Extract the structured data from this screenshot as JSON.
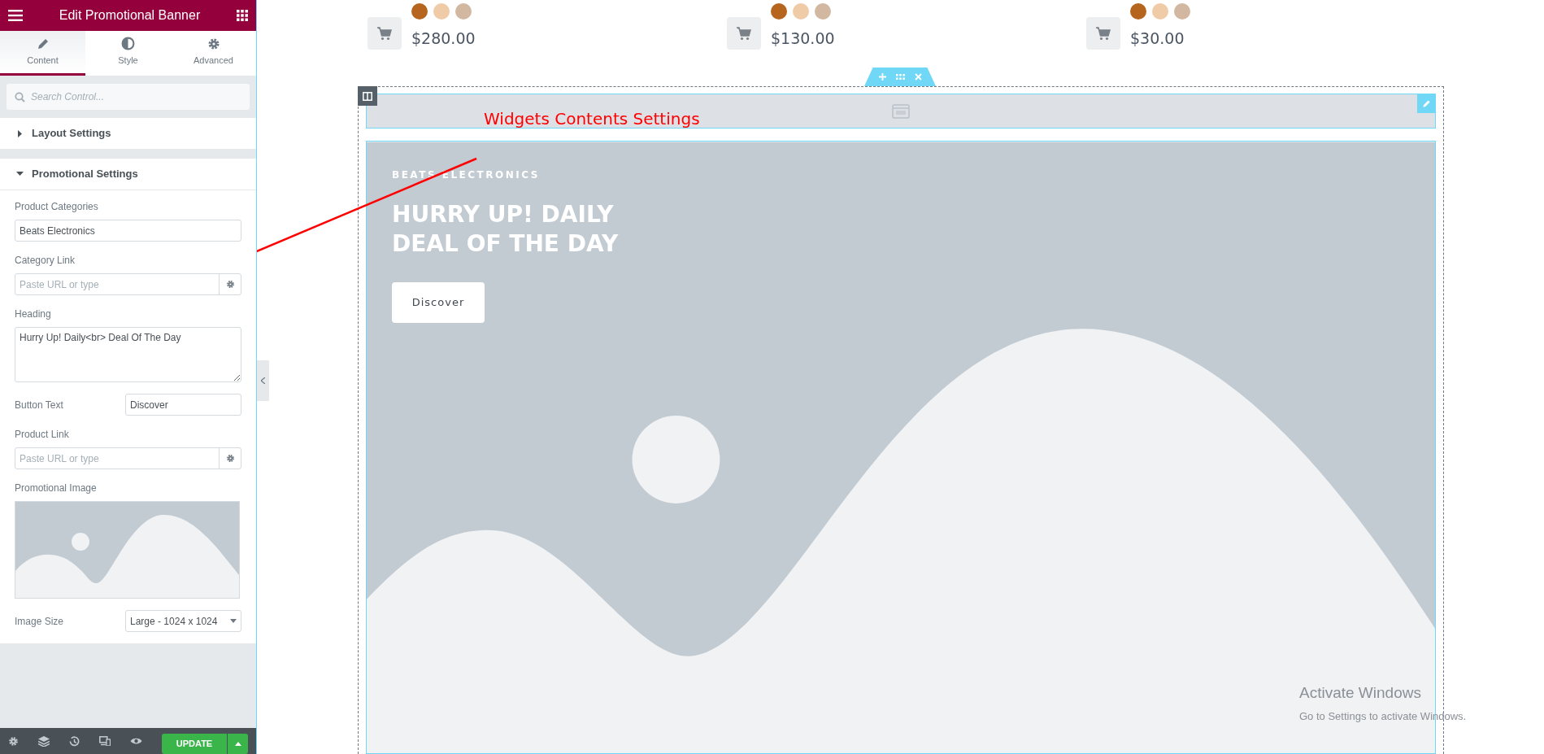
{
  "panel": {
    "title": "Edit Promotional Banner",
    "tabs": [
      {
        "label": "Content",
        "selected": true
      },
      {
        "label": "Style",
        "selected": false
      },
      {
        "label": "Advanced",
        "selected": false
      }
    ],
    "search": {
      "placeholder": "Search Control..."
    },
    "sections": [
      {
        "title": "Layout Settings",
        "expanded": false
      },
      {
        "title": "Promotional Settings",
        "expanded": true,
        "fields": [
          {
            "kind": "text",
            "label": "Product Categories",
            "value": "Beats Electronics"
          },
          {
            "kind": "url",
            "label": "Category Link",
            "placeholder": "Paste URL or type"
          },
          {
            "kind": "textarea",
            "label": "Heading",
            "value": "Hurry Up! Daily<br> Deal Of The Day"
          },
          {
            "kind": "inline",
            "label": "Button Text",
            "value": "Discover"
          },
          {
            "kind": "url",
            "label": "Product Link",
            "placeholder": "Paste URL or type"
          },
          {
            "kind": "image",
            "label": "Promotional Image"
          },
          {
            "kind": "select",
            "label": "Image Size",
            "value": "Large - 1024 x 1024"
          }
        ]
      }
    ],
    "update_button": "UPDATE"
  },
  "products": [
    {
      "swatches": [
        {
          "color": "#b5651d"
        },
        {
          "color": "#f0cba8"
        },
        {
          "color": "#d2b8a0"
        }
      ],
      "price": "$280.00"
    },
    {
      "swatches": [
        {
          "color": "#b5651d"
        },
        {
          "color": "#f0cba8"
        },
        {
          "color": "#d2b8a0"
        }
      ],
      "price": "$130.00"
    },
    {
      "swatches": [
        {
          "color": "#b5651d"
        },
        {
          "color": "#f0cba8"
        },
        {
          "color": "#d2b8a0"
        }
      ],
      "price": "$30.00"
    }
  ],
  "banner": {
    "subtitle": "BEATS ELECTRONICS",
    "heading_lines": [
      "HURRY UP! DAILY",
      "DEAL OF THE DAY"
    ],
    "button": "Discover"
  },
  "annotation": "Widgets Contents Settings",
  "os_notice": {
    "title": "Activate Windows",
    "text": "Go to Settings to activate Windows."
  }
}
